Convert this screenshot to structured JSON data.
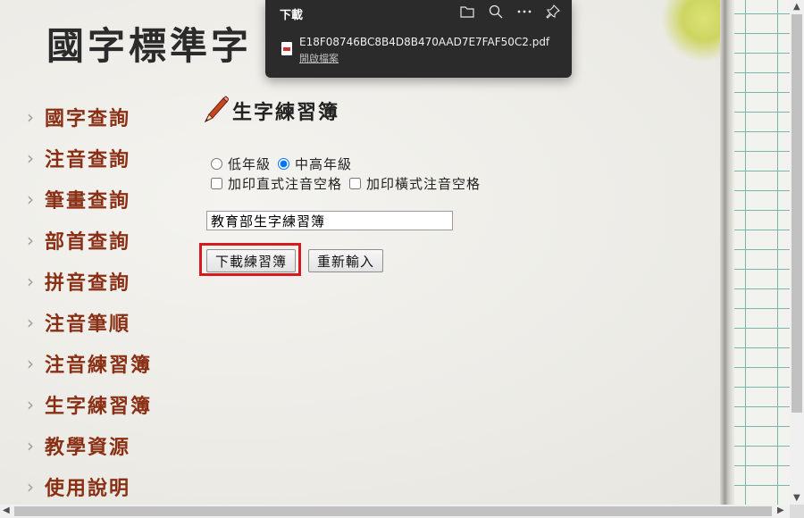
{
  "site": {
    "title": "國字標準字"
  },
  "nav": {
    "items": [
      {
        "label": "國字查詢"
      },
      {
        "label": "注音查詢"
      },
      {
        "label": "筆畫查詢"
      },
      {
        "label": "部首查詢"
      },
      {
        "label": "拼音查詢"
      },
      {
        "label": "注音筆順"
      },
      {
        "label": "注音練習簿"
      },
      {
        "label": "生字練習簿"
      },
      {
        "label": "教學資源"
      },
      {
        "label": "使用說明"
      }
    ],
    "chevron": "›"
  },
  "section": {
    "title": "生字練習簿",
    "icon": "pencil-icon"
  },
  "form": {
    "grade_low": "低年級",
    "grade_midhigh": "中高年級",
    "selected_grade": "中高年級",
    "opt_vertical": "加印直式注音空格",
    "opt_horizontal": "加印橫式注音空格",
    "text_value": "教育部生字練習簿",
    "download_label": "下載練習簿",
    "reset_label": "重新輸入"
  },
  "download_panel": {
    "title": "下載",
    "filename": "E18F08746BC8B4D8B470AAD7E7FAF50C2.pdf",
    "open_label": "開啟檔案",
    "icons": [
      "folder-icon",
      "search-icon",
      "more-icon",
      "pin-icon"
    ]
  },
  "colors": {
    "nav_text": "#8a2f14",
    "highlight": "#d61a1f",
    "panel_bg": "#2b2b2b"
  }
}
